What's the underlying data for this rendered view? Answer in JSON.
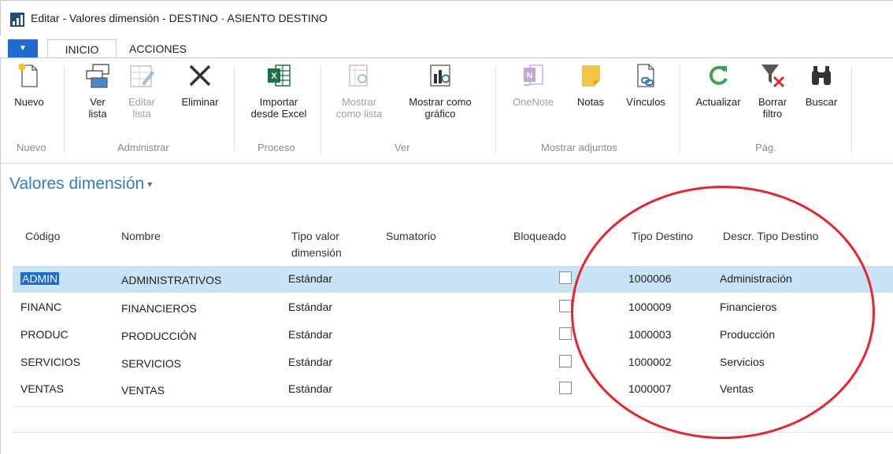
{
  "window": {
    "title": "Editar - Valores dimensión - DESTINO · ASIENTO DESTINO"
  },
  "tabs": {
    "menu": "▼",
    "inicio": "INICIO",
    "acciones": "ACCIONES"
  },
  "ribbon": {
    "nuevo": "Nuevo",
    "ver_lista": "Ver lista",
    "editar_lista": "Editar lista",
    "eliminar": "Eliminar",
    "importar": "Importar desde Excel",
    "mostrar_lista": "Mostrar como lista",
    "mostrar_grafico": "Mostrar como gráfico",
    "onenote": "OneNote",
    "notas": "Notas",
    "vinculos": "Vínculos",
    "actualizar": "Actualizar",
    "borrar_filtro": "Borrar filtro",
    "buscar": "Buscar",
    "groups": {
      "nuevo": "Nuevo",
      "administrar": "Administrar",
      "proceso": "Proceso",
      "ver": "Ver",
      "adjuntos": "Mostrar adjuntos",
      "pag": "Pág."
    }
  },
  "page": {
    "title": "Valores dimensión",
    "dropdown": "▾"
  },
  "table": {
    "headers": {
      "codigo": "Código",
      "nombre": "Nombre",
      "tipo_valor": "Tipo valor dimensión",
      "sumatorio": "Sumatorio",
      "bloqueado": "Bloqueado",
      "tipo_destino": "Tipo Destino",
      "descr": "Descr. Tipo Destino"
    },
    "rows": [
      {
        "codigo": "ADMIN",
        "nombre": "ADMINISTRATIVOS",
        "tipo": "Estándar",
        "tipo_destino": "1000006",
        "descr": "Administración"
      },
      {
        "codigo": "FINANC",
        "nombre": "FINANCIEROS",
        "tipo": "Estándar",
        "tipo_destino": "1000009",
        "descr": "Financieros"
      },
      {
        "codigo": "PRODUC",
        "nombre": "PRODUCCIÓN",
        "tipo": "Estándar",
        "tipo_destino": "1000003",
        "descr": "Producción"
      },
      {
        "codigo": "SERVICIOS",
        "nombre": "SERVICIOS",
        "tipo": "Estándar",
        "tipo_destino": "1000002",
        "descr": "Servicios"
      },
      {
        "codigo": "VENTAS",
        "nombre": "VENTAS",
        "tipo": "Estándar",
        "tipo_destino": "1000007",
        "descr": "Ventas"
      }
    ]
  },
  "colors": {
    "accent": "#1f6bd1",
    "title": "#2f7fbf",
    "selected_row": "#c9e3f6",
    "annotation": "#e8242c"
  },
  "icons": [
    "app-icon",
    "new-icon",
    "view-list-icon",
    "edit-list-icon",
    "delete-icon",
    "excel-icon",
    "show-list-icon",
    "show-chart-icon",
    "onenote-icon",
    "notes-icon",
    "links-icon",
    "refresh-icon",
    "clear-filter-icon",
    "find-icon"
  ]
}
